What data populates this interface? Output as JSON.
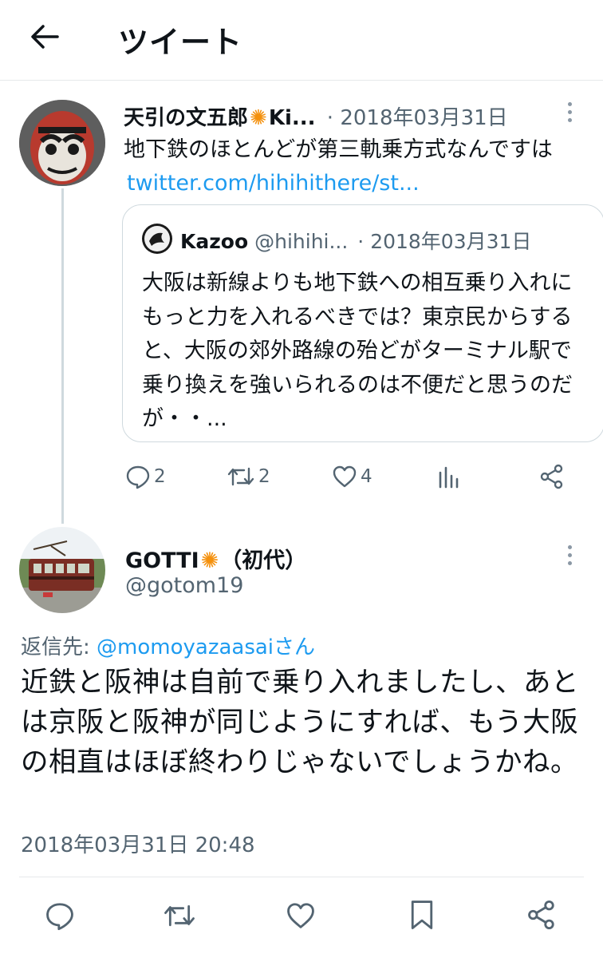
{
  "header": {
    "title": "ツイート",
    "back_icon": "arrow-left-icon"
  },
  "parent_tweet": {
    "display_name": "天引の文五郎",
    "name_suffix": "Ki...",
    "separator": "·",
    "date": "2018年03月31日",
    "text": "地下鉄のほとんどが第三軌乗方式なんですは",
    "link": "twitter.com/hihihithere/st...",
    "quote": {
      "display_name": "Kazoo",
      "handle": "@hihihi...",
      "separator": "·",
      "date": "2018年03月31日",
      "text": "大阪は新線よりも地下鉄への相互乗り入れにもっと力を入れるべきでは？東京民からすると、大阪の郊外路線の殆どがターミナル駅で乗り換えを強いられるのは不便だと思うのだが・・..."
    },
    "actions": {
      "replies": "2",
      "retweets": "2",
      "likes": "4"
    }
  },
  "reply_tweet": {
    "display_name": "GOTTI",
    "name_suffix": "（初代）",
    "handle": "@gotom19",
    "reply_to_label": "返信先: ",
    "reply_to_handle": "@momoyazaasai",
    "reply_to_suffix": "さん",
    "text": "近鉄と阪神は自前で乗り入れましたし、あとは京阪と阪神が同じようにすれば、もう大阪の相直はほぼ終わりじゃないでしょうかね。",
    "timestamp": "2018年03月31日 20:48"
  },
  "colors": {
    "accent": "#1d9bf0",
    "secondary": "#536471",
    "border": "#cfd9de",
    "sun_badge": "#f4900c"
  }
}
